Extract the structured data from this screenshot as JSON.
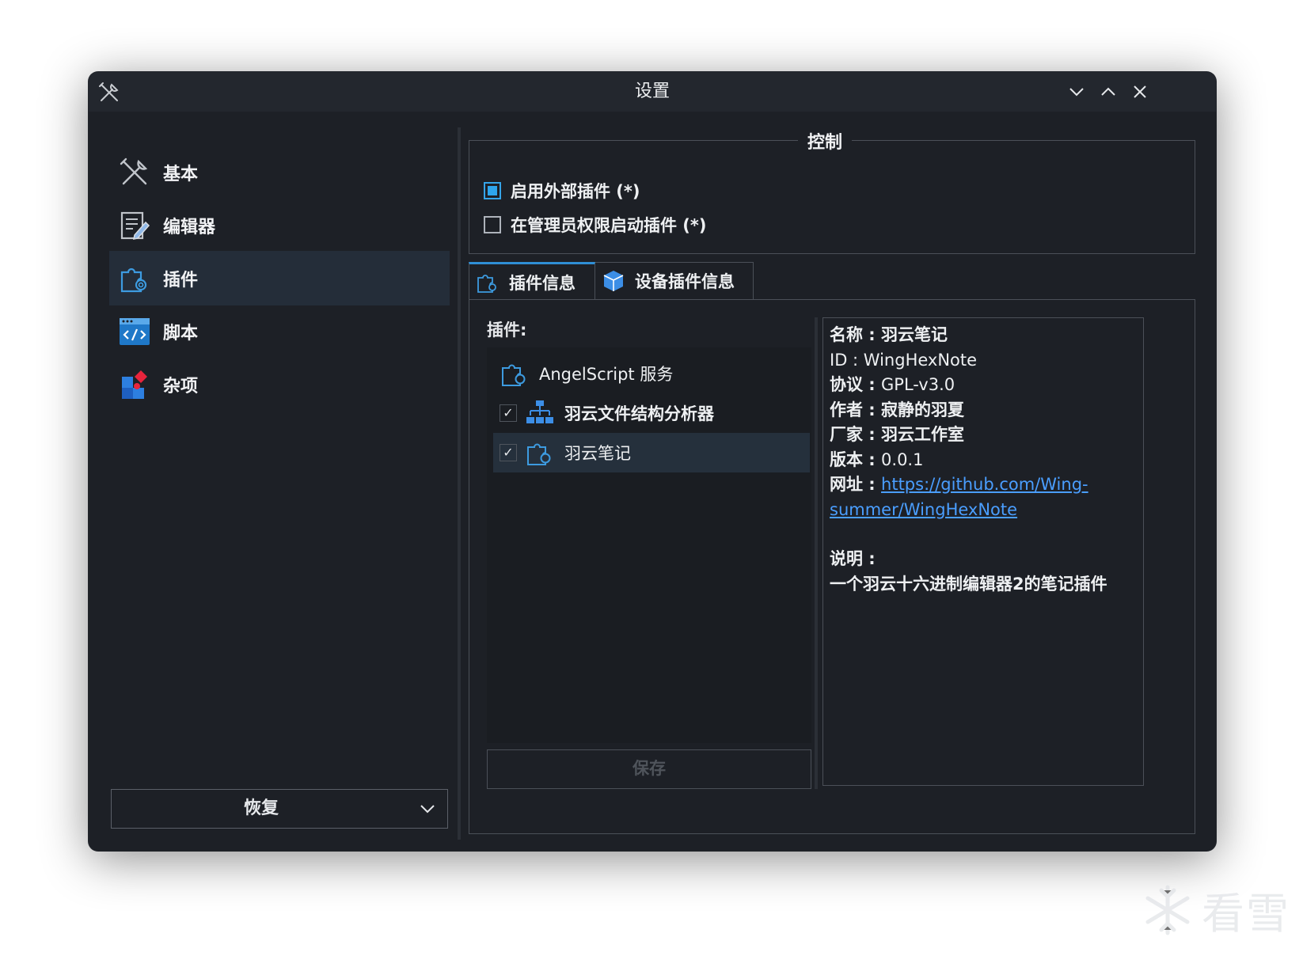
{
  "window": {
    "title": "设置",
    "controls": [
      "minimize",
      "maximize",
      "close"
    ]
  },
  "sidebar": {
    "items": [
      {
        "label": "基本",
        "icon": "wrench-screwdriver-icon"
      },
      {
        "label": "编辑器",
        "icon": "editor-pencil-icon"
      },
      {
        "label": "插件",
        "icon": "puzzle-gear-icon",
        "active": true
      },
      {
        "label": "脚本",
        "icon": "code-window-icon"
      },
      {
        "label": "杂项",
        "icon": "misc-shapes-icon"
      }
    ],
    "restore_label": "恢复"
  },
  "control_group": {
    "legend": "控制",
    "enable_external": {
      "label": "启用外部插件 (*)",
      "checked": true
    },
    "admin_plugins": {
      "label": "在管理员权限启动插件 (*)",
      "checked": false
    }
  },
  "tabs": [
    {
      "label": "插件信息",
      "icon": "puzzle-gear-icon",
      "active": true
    },
    {
      "label": "设备插件信息",
      "icon": "cube-icon"
    }
  ],
  "plugins": {
    "label": "插件:",
    "items": [
      {
        "label": "AngelScript 服务",
        "icon": "puzzle-gear-icon",
        "checkable": false
      },
      {
        "label": "羽云文件结构分析器",
        "icon": "hierarchy-icon",
        "checkable": true,
        "checked": true
      },
      {
        "label": "羽云笔记",
        "icon": "puzzle-gear-icon",
        "checkable": true,
        "checked": true,
        "selected": true
      }
    ],
    "save_label": "保存"
  },
  "info": {
    "name_k": "名称 : ",
    "name_v": "羽云笔记",
    "id_k": "ID : ",
    "id_v": "WingHexNote",
    "license_k": "协议 : ",
    "license_v": "GPL-v3.0",
    "author_k": "作者 : ",
    "author_v": "寂静的羽夏",
    "vendor_k": "厂家 : ",
    "vendor_v": "羽云工作室",
    "version_k": "版本 : ",
    "version_v": "0.0.1",
    "url_k": "网址 : ",
    "url_v1": "https://github.com/Wing-",
    "url_v2": "summer/WingHexNote",
    "desc_k": "说明 :",
    "desc_v": "一个羽云十六进制编辑器2的笔记插件"
  },
  "watermark": {
    "text": "看雪"
  },
  "colors": {
    "accent": "#2ea5ec",
    "link": "#4a9eff",
    "window_bg": "#1d2026"
  }
}
